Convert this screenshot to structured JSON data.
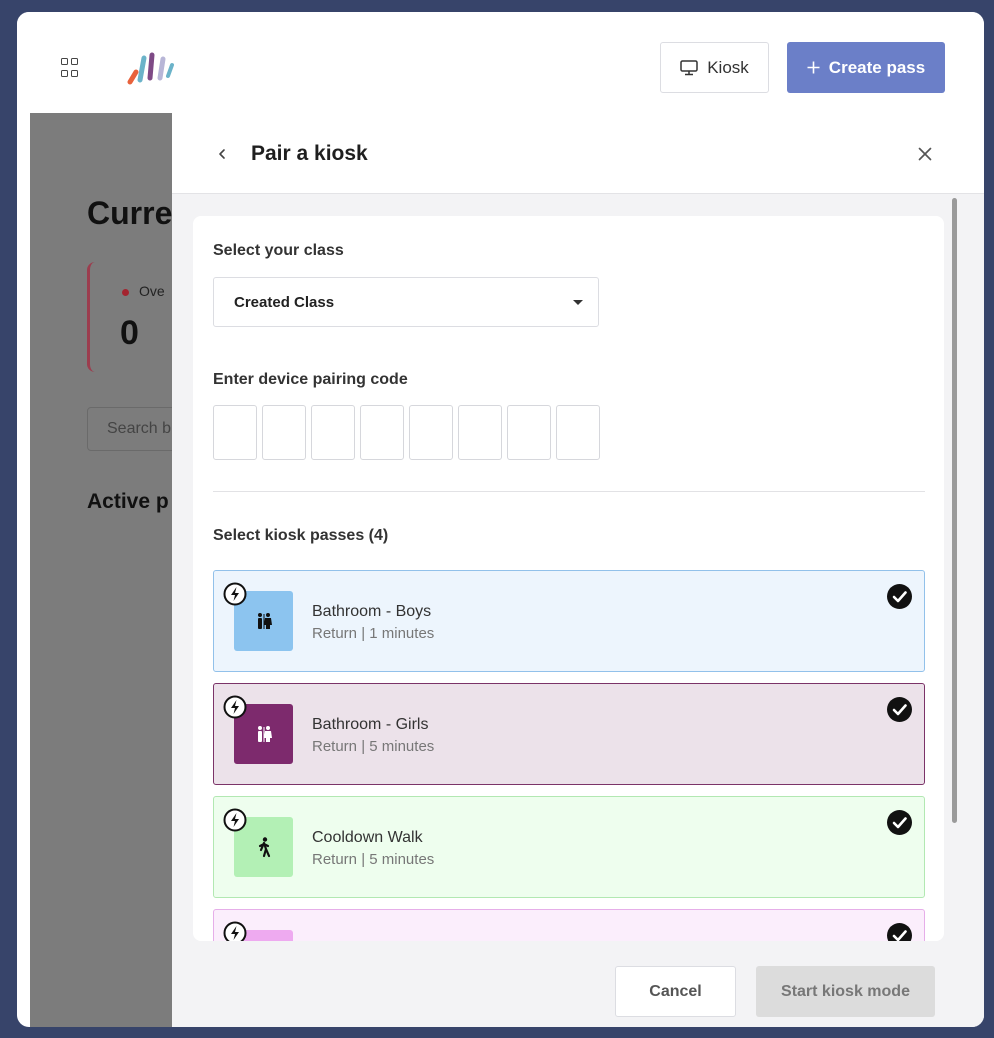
{
  "header": {
    "kiosk_label": "Kiosk",
    "create_pass_label": "Create pass"
  },
  "background": {
    "title": "Curre",
    "card_label": "Ove",
    "card_value": "0",
    "search_placeholder": "Search b",
    "active_heading": "Active p"
  },
  "panel": {
    "title": "Pair a kiosk",
    "class_label": "Select your class",
    "class_value": "Created Class",
    "pairing_label": "Enter device pairing code",
    "pairing_code": [
      "",
      "",
      "",
      "",
      "",
      "",
      "",
      ""
    ],
    "passes_label": "Select kiosk passes (4)",
    "passes": [
      {
        "name": "Bathroom - Boys",
        "sub": "Return | 1 minutes",
        "icon": "restroom-icon",
        "bg": "#edf5fd",
        "border": "#92c1ea",
        "tile": "#8cc4ef",
        "selected": true
      },
      {
        "name": "Bathroom - Girls",
        "sub": "Return | 5 minutes",
        "icon": "restroom-icon",
        "bg": "#ece2ea",
        "border": "#7b3368",
        "tile": "#7d2a6d",
        "selected": true
      },
      {
        "name": "Cooldown Walk",
        "sub": "Return | 5 minutes",
        "icon": "walking-icon",
        "bg": "#eefeee",
        "border": "#b2e8b2",
        "tile": "#b3f0b5",
        "selected": true
      },
      {
        "name": "",
        "sub": "",
        "icon": "pass-icon",
        "bg": "#fbeefc",
        "border": "#e6aee9",
        "tile": "#eeaaf0",
        "selected": true
      }
    ]
  },
  "footer": {
    "cancel_label": "Cancel",
    "start_label": "Start kiosk mode"
  },
  "colors": {
    "accent": "#6b7fc8",
    "backdrop": "#37446a"
  }
}
